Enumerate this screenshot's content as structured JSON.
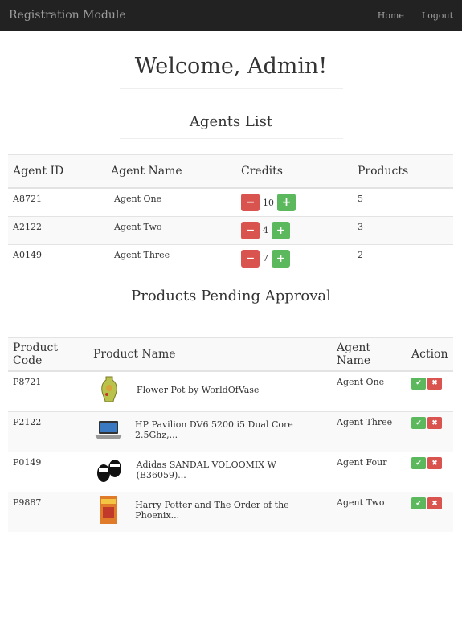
{
  "navbar": {
    "brand": "Registration Module",
    "home": "Home",
    "logout": "Logout"
  },
  "welcome": "Welcome, Admin!",
  "agents": {
    "title": "Agents List",
    "headers": [
      "Agent ID",
      "Agent Name",
      "Credits",
      "Products"
    ],
    "rows": [
      {
        "id": "A8721",
        "name": "Agent One",
        "credits": "10",
        "products": "5"
      },
      {
        "id": "A2122",
        "name": "Agent Two",
        "credits": "4",
        "products": "3"
      },
      {
        "id": "A0149",
        "name": "Agent Three",
        "credits": "7",
        "products": "2"
      }
    ]
  },
  "products": {
    "title": "Products Pending Approval",
    "headers": [
      "Product Code",
      "Product Name",
      "Agent Name",
      "Action"
    ],
    "rows": [
      {
        "code": "P8721",
        "name": "Flower Pot by WorldOfVase",
        "agent": "Agent One",
        "thumb": "vase-icon"
      },
      {
        "code": "P2122",
        "name": "HP Pavilion DV6 5200 i5 Dual Core 2.5Ghz,...",
        "agent": "Agent Three",
        "thumb": "laptop-icon"
      },
      {
        "code": "P0149",
        "name": "Adidas SANDAL VOLOOMIX W (B36059)...",
        "agent": "Agent Four",
        "thumb": "sandal-icon"
      },
      {
        "code": "P9887",
        "name": "Harry Potter and The Order of the Phoenix...",
        "agent": "Agent Two",
        "thumb": "book-icon"
      }
    ]
  },
  "colors": {
    "danger": "#d9534f",
    "success": "#5cb85c",
    "navbar": "#222222"
  }
}
